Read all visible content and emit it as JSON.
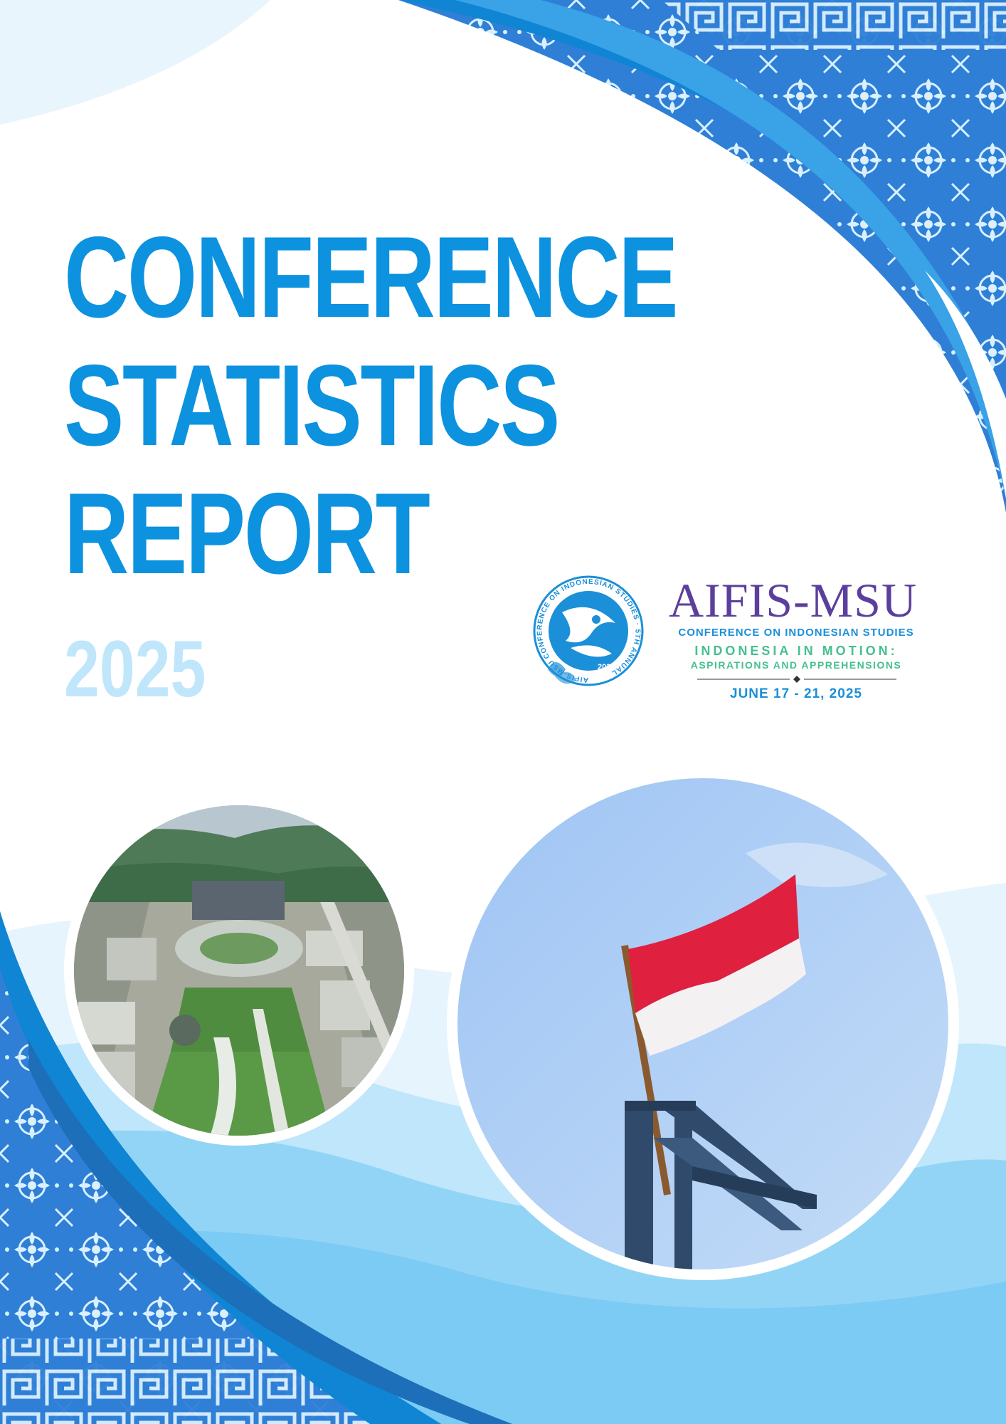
{
  "cover": {
    "title_lines": [
      "CONFERENCE",
      "STATISTICS",
      "REPORT"
    ],
    "year": "2025"
  },
  "logo": {
    "emblem_ring_text": "AIFIS-MSU CONFERENCE ON INDONESIAN STUDIES · 5TH ANNUAL",
    "emblem_year": "2025",
    "brand_name": "AIFIS-MSU",
    "subtitle": "CONFERENCE ON INDONESIAN STUDIES",
    "theme": "INDONESIA IN MOTION:",
    "theme_sub": "ASPIRATIONS AND APPREHENSIONS",
    "dates": "JUNE 17 - 21, 2025"
  },
  "colors": {
    "title": "#0c92df",
    "year": "#bfe6fb",
    "brand": "#5b3f9c",
    "accent_blue": "#1b8fd8",
    "accent_green": "#46c08f",
    "batik_blue": "#2f7fd6"
  },
  "images": {
    "city": "aerial-city-photo",
    "flag": "indonesian-flag-photo"
  }
}
